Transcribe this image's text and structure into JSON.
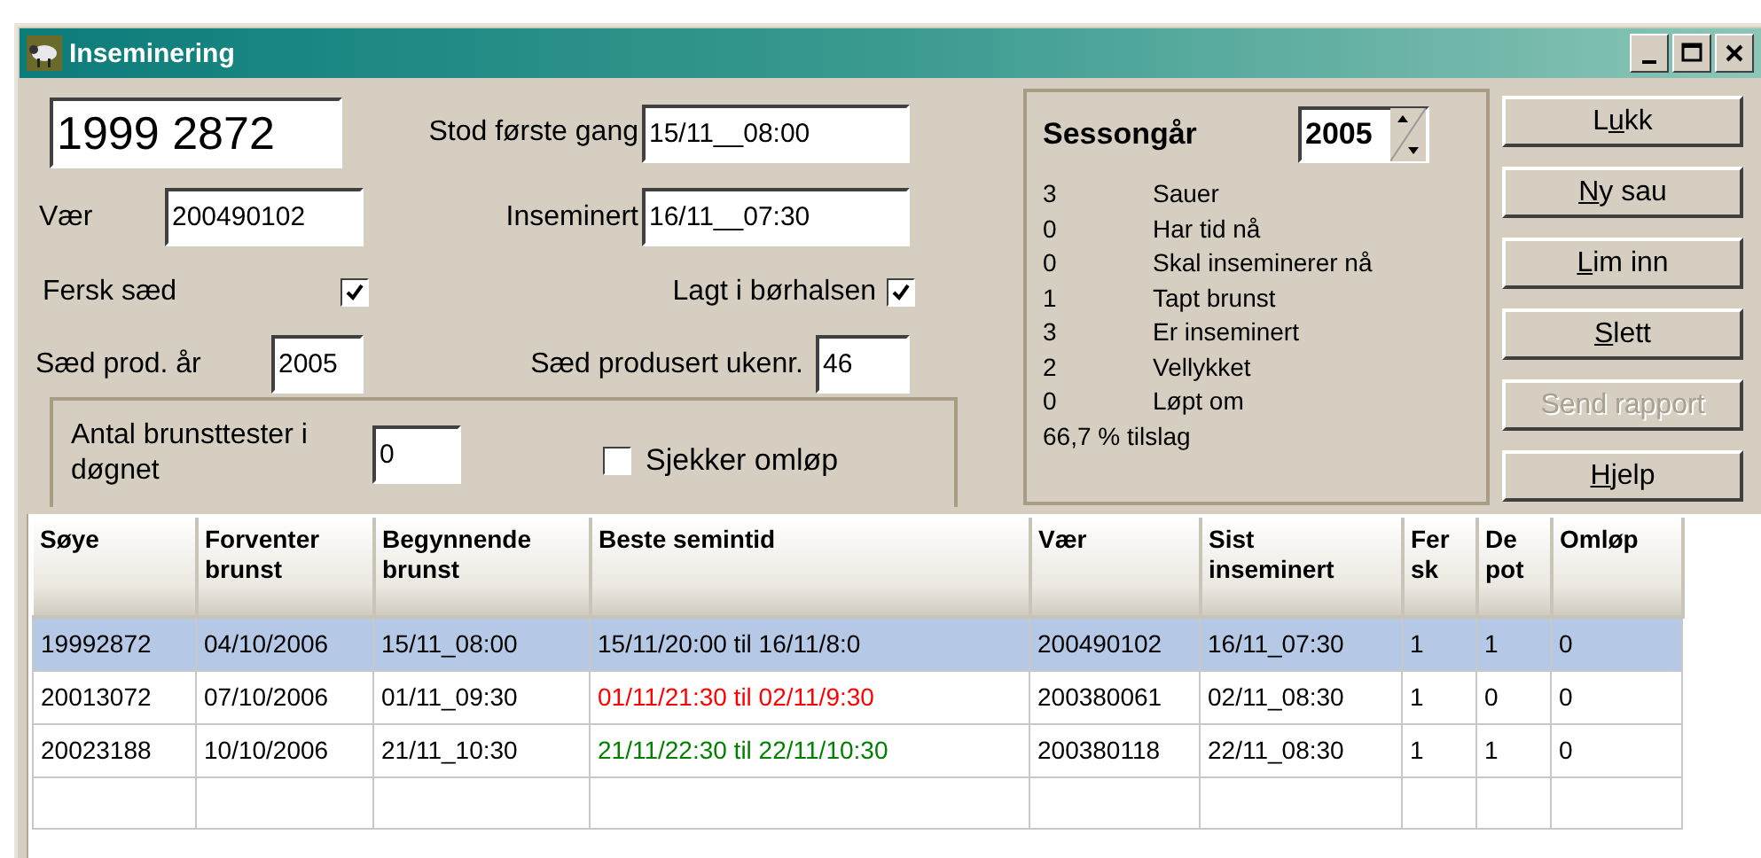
{
  "window": {
    "title": "Inseminering"
  },
  "form": {
    "id_value": "1999 2872",
    "first_stand": {
      "label": "Stod første gang",
      "value": "15/11__08:00"
    },
    "ram": {
      "label": "Vær",
      "value": "200490102"
    },
    "inseminated": {
      "label": "Inseminert",
      "value": "16/11__07:30"
    },
    "fresh_semen": {
      "label": "Fersk sæd",
      "checked": true
    },
    "cervix": {
      "label": "Lagt i børhalsen",
      "checked": true
    },
    "prod_year": {
      "label": "Sæd prod. år",
      "value": "2005"
    },
    "prod_week": {
      "label": "Sæd produsert ukenr.",
      "value": "46"
    },
    "heat_tests": {
      "label": "Antal brunsttester i døgnet",
      "value": "0"
    },
    "check_return": {
      "label": "Sjekker omløp",
      "checked": false
    }
  },
  "season": {
    "label": "Sessongår",
    "value": "2005",
    "stats": [
      {
        "count": "3",
        "label": "Sauer"
      },
      {
        "count": "0",
        "label": "Har tid nå"
      },
      {
        "count": "0",
        "label": "Skal inseminerer nå"
      },
      {
        "count": "1",
        "label": "Tapt brunst"
      },
      {
        "count": "3",
        "label": "Er inseminert"
      },
      {
        "count": "2",
        "label": "Vellykket"
      },
      {
        "count": "0",
        "label": "Løpt om"
      }
    ],
    "rate": "66,7 % tilslag"
  },
  "buttons": [
    {
      "pre": "L",
      "key": "u",
      "post": "kk",
      "disabled": false
    },
    {
      "key": "N",
      "post": "y sau",
      "disabled": false
    },
    {
      "key": "L",
      "post": "im inn",
      "disabled": false
    },
    {
      "key": "S",
      "post": "lett",
      "disabled": false
    },
    {
      "label": "Send rapport",
      "disabled": true
    },
    {
      "key": "H",
      "post": "jelp",
      "disabled": false
    }
  ],
  "table": {
    "columns": [
      "Søye",
      "Forventer brunst",
      "Begynnende brunst",
      "Beste semintid",
      "Vær",
      "Sist inseminert",
      "Fersk",
      "Depot",
      "Omløp"
    ],
    "rows": [
      {
        "selected": true,
        "color": "#000000",
        "cells": [
          "19992872",
          "04/10/2006",
          "15/11_08:00",
          "15/11/20:00 til 16/11/8:0",
          "200490102",
          "16/11_07:30",
          "1",
          "1",
          "0"
        ]
      },
      {
        "selected": false,
        "color": "#ff0000",
        "cells": [
          "20013072",
          "07/10/2006",
          "01/11_09:30",
          "01/11/21:30 til 02/11/9:30",
          "200380061",
          "02/11_08:30",
          "1",
          "0",
          "0"
        ]
      },
      {
        "selected": false,
        "color": "#008000",
        "cells": [
          "20023188",
          "10/10/2006",
          "21/11_10:30",
          "21/11/22:30 til 22/11/10:30",
          "200380118",
          "22/11_08:30",
          "1",
          "1",
          "0"
        ]
      }
    ]
  }
}
